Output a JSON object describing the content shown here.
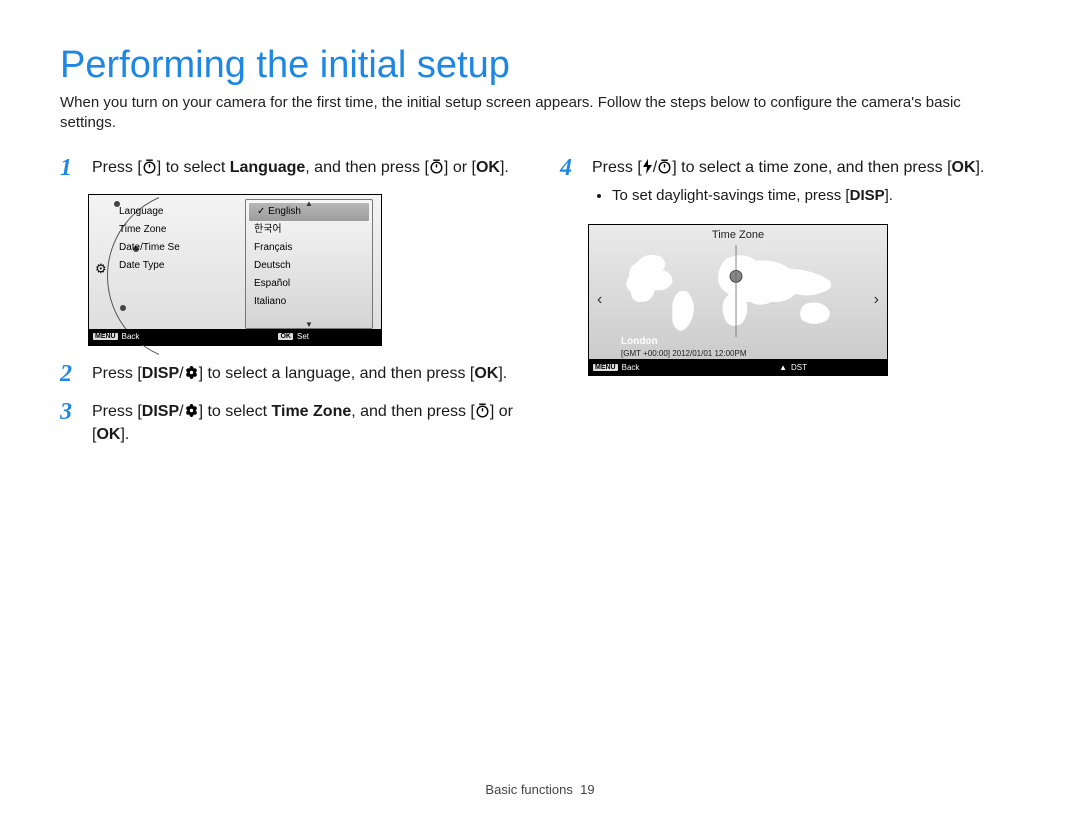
{
  "page": {
    "title": "Performing the initial setup",
    "intro": "When you turn on your camera for the first time, the initial setup screen appears. Follow the steps below to configure the camera's basic settings.",
    "footer_section": "Basic functions",
    "footer_page": "19"
  },
  "icons": {
    "timer": "◌",
    "ok": "OK",
    "disp": "DISP",
    "flower": "❀",
    "flash": "⚡",
    "chev_up": "▲",
    "chev_down": "▼",
    "chev_left": "‹",
    "chev_right": "›",
    "up_tri": "▲"
  },
  "steps": {
    "s1_a": "Press [",
    "s1_b": "] to select ",
    "s1_bold": "Language",
    "s1_c": ", and then press [",
    "s1_d": "] or [",
    "s1_e": "].",
    "s2_a": "Press [",
    "s2_b": "] to select a language, and then press [",
    "s2_c": "].",
    "s3_a": "Press [",
    "s3_b": "] to select ",
    "s3_bold": "Time Zone",
    "s3_c": ", and then press [",
    "s3_d": "] or [",
    "s3_e": "].",
    "s4_a": "Press [",
    "s4_b": "] to select a time zone, and then press [",
    "s4_c": "].",
    "s4_bullet_a": "To set daylight-savings time, press [",
    "s4_bullet_b": "]."
  },
  "shot1": {
    "left_items": [
      "Language",
      "Time Zone",
      "Date/Time Se",
      "Date Type"
    ],
    "panel_items": [
      "English",
      "한국어",
      "Français",
      "Deutsch",
      "Español",
      "Italiano"
    ],
    "selected_index": 0,
    "bar_menu": "MENU",
    "bar_back": "Back",
    "bar_ok": "OK",
    "bar_set": "Set",
    "check": "✓"
  },
  "shot2": {
    "title": "Time Zone",
    "city": "London",
    "gmt": "[GMT +00:00]   2012/01/01   12:00PM",
    "bar_menu": "MENU",
    "bar_back": "Back",
    "bar_dst": "DST"
  }
}
